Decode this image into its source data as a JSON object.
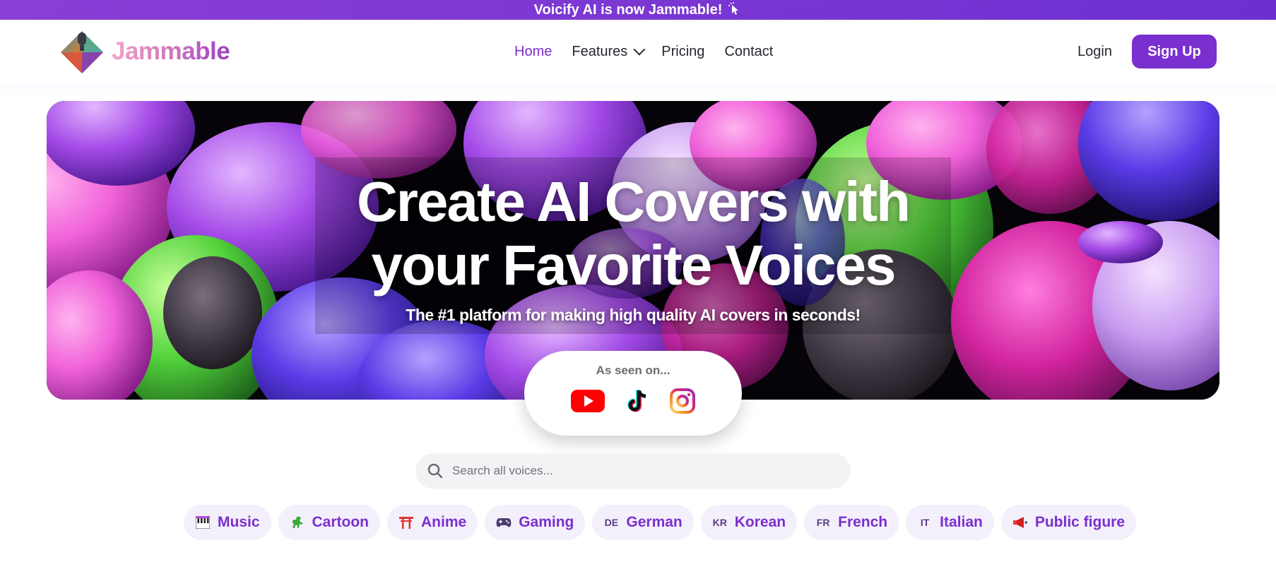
{
  "announcement": {
    "text": "Voicify AI is now Jammable!",
    "icon": "cursor-click-icon"
  },
  "brand": {
    "name": "Jammable"
  },
  "nav": {
    "items": [
      {
        "label": "Home",
        "active": true
      },
      {
        "label": "Features",
        "dropdown": true
      },
      {
        "label": "Pricing"
      },
      {
        "label": "Contact"
      }
    ],
    "login_label": "Login",
    "signup_label": "Sign Up"
  },
  "hero": {
    "title_line1": "Create AI Covers with",
    "title_line2": "your Favorite Voices",
    "subtitle": "The #1 platform for making high quality AI covers in seconds!"
  },
  "seen_on": {
    "label": "As seen on...",
    "platforms": [
      "youtube-icon",
      "tiktok-icon",
      "instagram-icon"
    ]
  },
  "search": {
    "placeholder": "Search all voices..."
  },
  "categories": [
    {
      "label": "Music",
      "icon": "piano-icon"
    },
    {
      "label": "Cartoon",
      "icon": "dinosaur-icon"
    },
    {
      "label": "Anime",
      "icon": "torii-gate-icon"
    },
    {
      "label": "Gaming",
      "icon": "gamepad-icon"
    },
    {
      "label": "German",
      "icon": "DE"
    },
    {
      "label": "Korean",
      "icon": "KR"
    },
    {
      "label": "French",
      "icon": "FR"
    },
    {
      "label": "Italian",
      "icon": "IT"
    },
    {
      "label": "Public figure",
      "icon": "megaphone-icon"
    }
  ],
  "colors": {
    "accent": "#7a2fcf",
    "chip_bg": "#f4f0fb",
    "search_bg": "#f3f2f4"
  }
}
